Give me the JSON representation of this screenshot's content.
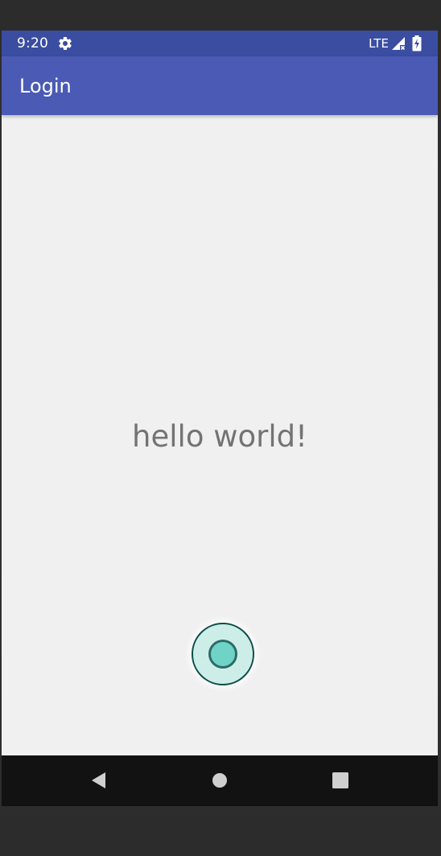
{
  "status_bar": {
    "time": "9:20",
    "network": "LTE",
    "settings_icon": "gear-icon",
    "signal_icon": "signal-icon",
    "battery_icon": "battery-charging-icon"
  },
  "app_bar": {
    "title": "Login"
  },
  "main": {
    "message": "hello world!"
  },
  "fab": {
    "icon": "record-circle-icon"
  },
  "nav_bar": {
    "back_icon": "back-icon",
    "home_icon": "home-icon",
    "recents_icon": "recents-icon"
  },
  "colors": {
    "status_bar": "#3a4da1",
    "app_bar": "#4a5ab5",
    "background": "#f0f0f0",
    "fab_outer": "#cdeee8",
    "fab_inner": "#6fd3c6",
    "nav_bar": "#121212"
  }
}
